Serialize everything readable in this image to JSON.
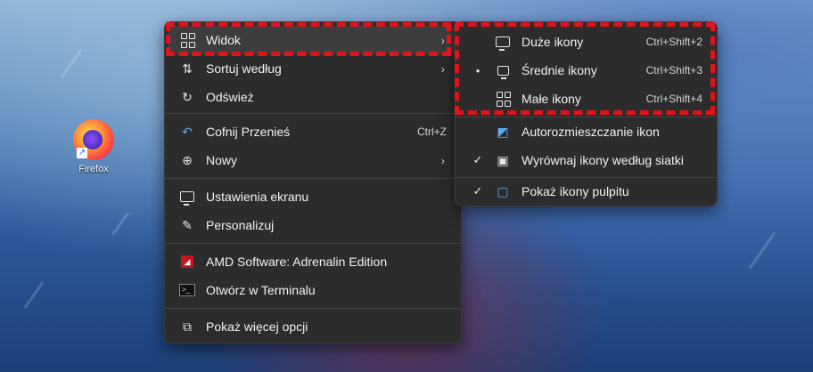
{
  "desktop": {
    "icons": [
      {
        "label": "Firefox",
        "icon": "firefox-icon"
      }
    ]
  },
  "context_menu": {
    "items": [
      {
        "label": "Widok",
        "icon": "view-grid-icon",
        "has_submenu": true,
        "highlighted": true
      },
      {
        "label": "Sortuj według",
        "icon": "sort-icon",
        "has_submenu": true
      },
      {
        "label": "Odśwież",
        "icon": "refresh-icon"
      },
      {
        "label": "Cofnij Przenieś",
        "icon": "undo-icon",
        "shortcut": "Ctrl+Z"
      },
      {
        "label": "Nowy",
        "icon": "plus-circle-icon",
        "has_submenu": true
      },
      {
        "label": "Ustawienia ekranu",
        "icon": "display-settings-icon"
      },
      {
        "label": "Personalizuj",
        "icon": "brush-icon"
      },
      {
        "label": "AMD Software: Adrenalin Edition",
        "icon": "amd-icon"
      },
      {
        "label": "Otwórz w Terminalu",
        "icon": "terminal-icon"
      },
      {
        "label": "Pokaż więcej opcji",
        "icon": "share-icon"
      }
    ]
  },
  "view_submenu": {
    "items": [
      {
        "label": "Duże ikony",
        "shortcut": "Ctrl+Shift+2",
        "icon": "monitor-icon",
        "mark": ""
      },
      {
        "label": "Średnie ikony",
        "shortcut": "Ctrl+Shift+3",
        "icon": "monitor-small-icon",
        "mark": "•"
      },
      {
        "label": "Małe ikony",
        "shortcut": "Ctrl+Shift+4",
        "icon": "grid-small-icon",
        "mark": ""
      },
      {
        "label": "Autorozmieszczanie ikon",
        "shortcut": "",
        "icon": "auto-arrange-icon",
        "mark": ""
      },
      {
        "label": "Wyrównaj ikony według siatki",
        "shortcut": "",
        "icon": "align-grid-icon",
        "mark": "✓"
      },
      {
        "label": "Pokaż ikony pulpitu",
        "shortcut": "",
        "icon": "show-desktop-icons-icon",
        "mark": "✓"
      }
    ]
  },
  "colors": {
    "menu_bg": "#2c2c2c",
    "highlight_bg": "#3d3d3d",
    "annotation": "#e0141e"
  }
}
